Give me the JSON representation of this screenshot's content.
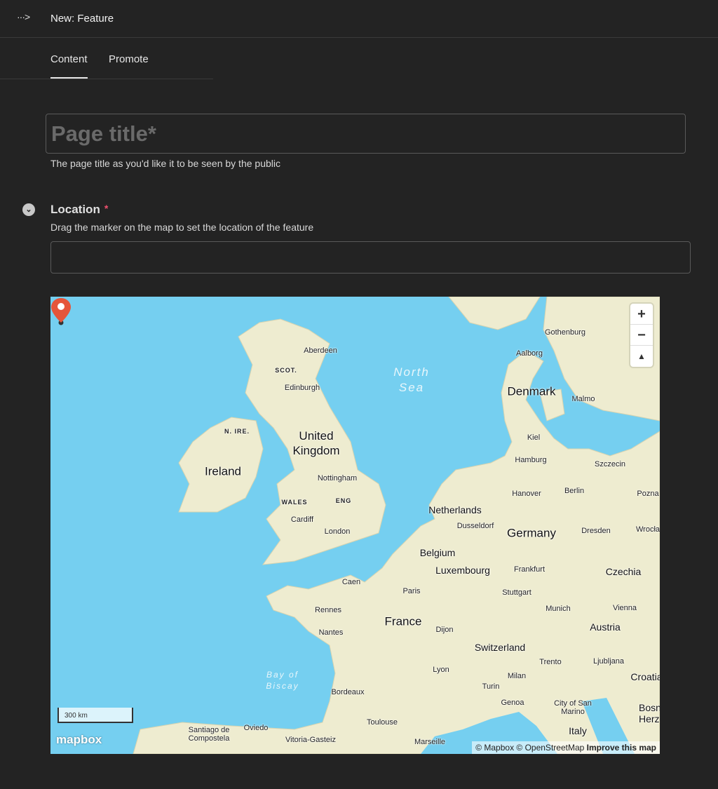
{
  "header": {
    "menu_icon": "more-arrow-icon",
    "menu_glyph": "···>",
    "title": "New: Feature"
  },
  "tabs": [
    {
      "label": "Content",
      "active": true
    },
    {
      "label": "Promote",
      "active": false
    }
  ],
  "page_title": {
    "placeholder": "Page title*",
    "value": "",
    "help": "The page title as you'd like it to be seen by the public"
  },
  "location": {
    "label": "Location",
    "required_mark": "*",
    "help": "Drag the marker on the map to set the location of the feature",
    "value": ""
  },
  "map": {
    "colors": {
      "sea": "#75cff0",
      "land": "#eeecd0",
      "marker": "#e5553a"
    },
    "zoom_in": "+",
    "zoom_out": "−",
    "compass": "▲",
    "scale": "300 km",
    "logo": "mapbox",
    "attribution": "© Mapbox © OpenStreetMap",
    "improve": "Improve this map",
    "labels": {
      "aberdeen": "Aberdeen",
      "scot": "SCOT.",
      "edinburgh": "Edinburgh",
      "nire": "N. IRE.",
      "uk": "United Kingdom",
      "ireland": "Ireland",
      "nottingham": "Nottingham",
      "wales": "WALES",
      "eng": "ENG",
      "cardiff": "Cardiff",
      "london": "London",
      "caen": "Caen",
      "rennes": "Rennes",
      "nantes": "Nantes",
      "biscay": "Bay of Biscay",
      "bordeaux": "Bordeaux",
      "santiago": "Santiago de Compostela",
      "oviedo": "Oviedo",
      "vitoria": "Vitoria-Gasteiz",
      "toulouse": "Toulouse",
      "marseille": "Marseille",
      "north_sea": "North Sea",
      "denmark": "Denmark",
      "aalborg": "Aalborg",
      "gothenburg": "Gothenburg",
      "malmo": "Malmo",
      "kiel": "Kiel",
      "hamburg": "Hamburg",
      "szczecin": "Szczecin",
      "berlin": "Berlin",
      "hanover": "Hanover",
      "netherlands": "Netherlands",
      "dusseldorf": "Dusseldorf",
      "germany": "Germany",
      "dresden": "Dresden",
      "belgium": "Belgium",
      "luxembourg": "Luxembourg",
      "frankfurt": "Frankfurt",
      "czechia": "Czechia",
      "paris": "Paris",
      "stuttgart": "Stuttgart",
      "munich": "Munich",
      "vienna": "Vienna",
      "france": "France",
      "austria": "Austria",
      "dijon": "Dijon",
      "switzerland": "Switzerland",
      "trento": "Trento",
      "ljubljana": "Ljubljana",
      "lyon": "Lyon",
      "milan": "Milan",
      "croatia": "Croatia",
      "turin": "Turin",
      "genoa": "Genoa",
      "san_marino": "City of San Marino",
      "italy": "Italy",
      "poznan": "Pozna",
      "wroclaw": "Wrocła",
      "bosnia": "Bosn Herz"
    }
  }
}
